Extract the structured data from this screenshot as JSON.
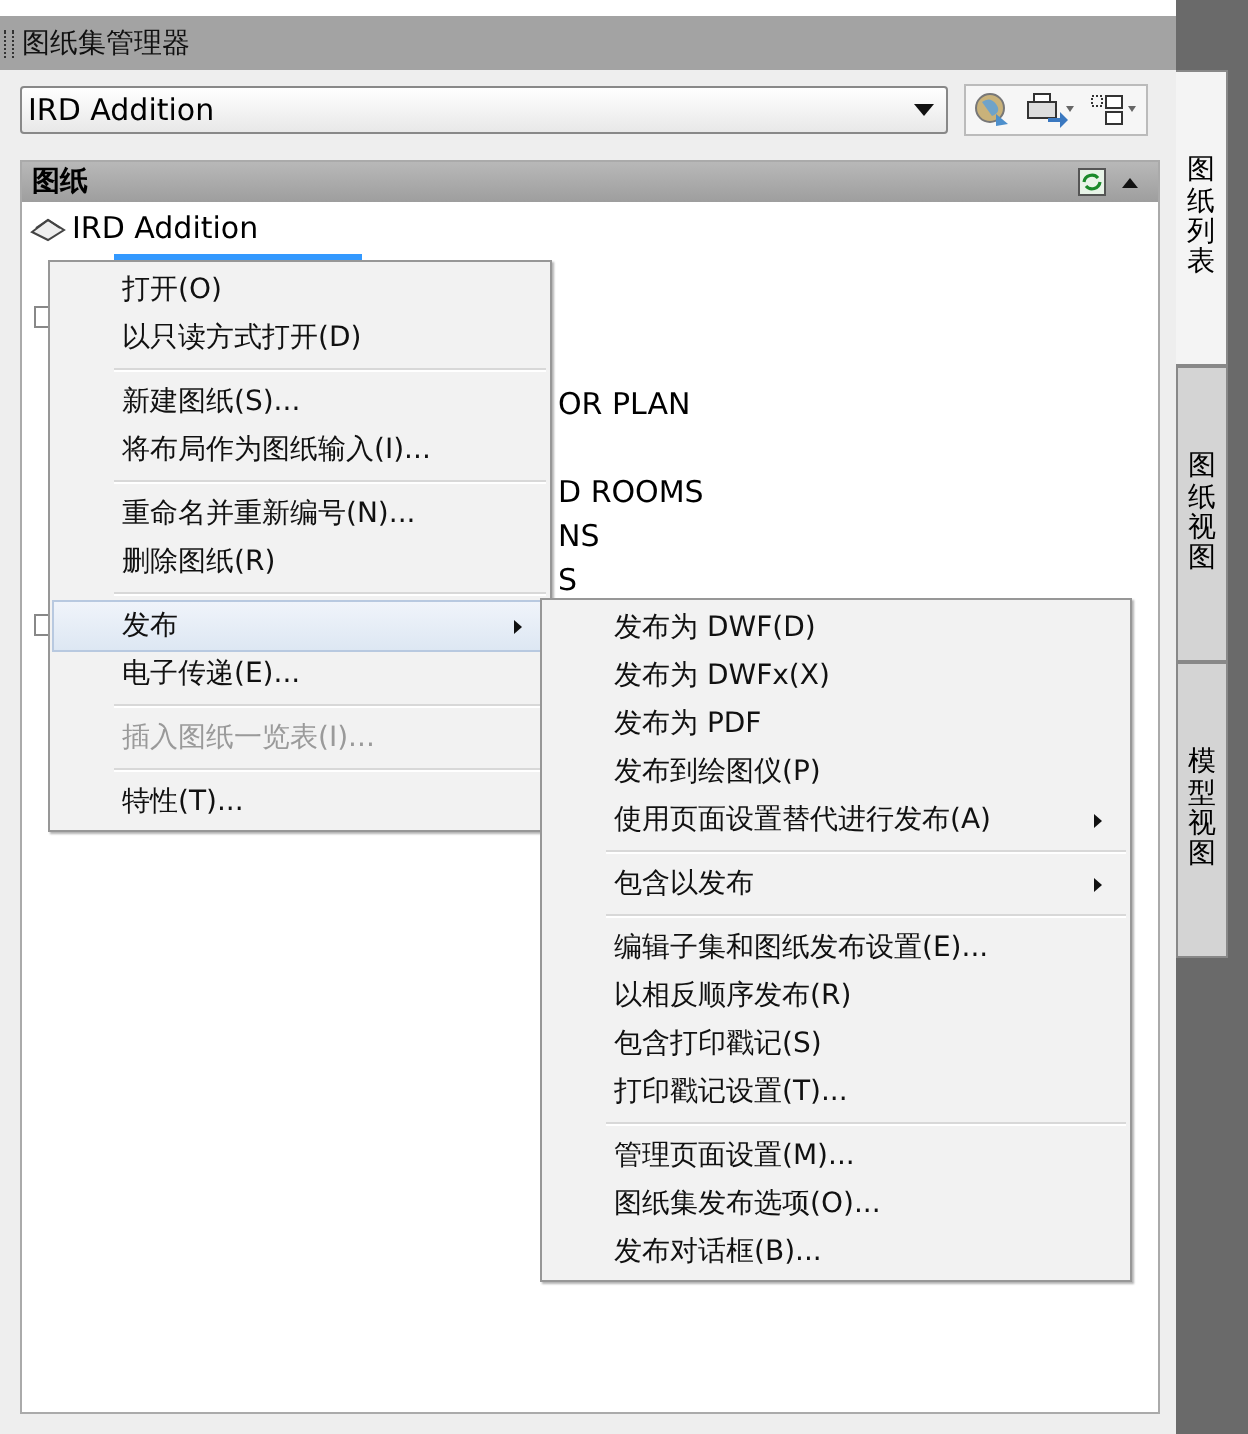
{
  "window": {
    "title": "图纸集管理器"
  },
  "sheet_set_dropdown": {
    "value": "IRD Addition"
  },
  "sheets_header": {
    "title": "图纸"
  },
  "tree": {
    "root": "IRD Addition",
    "rows": [
      {
        "kind": "selected",
        "text": ""
      },
      {
        "kind": "group",
        "text": ""
      },
      {
        "kind": "item",
        "text": ""
      },
      {
        "kind": "item",
        "text": "OR PLAN"
      },
      {
        "kind": "item",
        "text": ""
      },
      {
        "kind": "item",
        "text": "D ROOMS"
      },
      {
        "kind": "item",
        "text": "NS"
      },
      {
        "kind": "item",
        "text": "S"
      },
      {
        "kind": "group",
        "text": ""
      }
    ]
  },
  "context_menu": {
    "groups": [
      [
        {
          "label": "打开(O)",
          "disabled": false,
          "selected": false,
          "submenu": false
        },
        {
          "label": "以只读方式打开(D)",
          "disabled": false,
          "selected": false,
          "submenu": false
        }
      ],
      [
        {
          "label": "新建图纸(S)...",
          "disabled": false,
          "selected": false,
          "submenu": false
        },
        {
          "label": "将布局作为图纸输入(I)...",
          "disabled": false,
          "selected": false,
          "submenu": false
        }
      ],
      [
        {
          "label": "重命名并重新编号(N)...",
          "disabled": false,
          "selected": false,
          "submenu": false
        },
        {
          "label": "删除图纸(R)",
          "disabled": false,
          "selected": false,
          "submenu": false
        }
      ],
      [
        {
          "label": "发布",
          "disabled": false,
          "selected": true,
          "submenu": true
        },
        {
          "label": "电子传递(E)...",
          "disabled": false,
          "selected": false,
          "submenu": false
        }
      ],
      [
        {
          "label": "插入图纸一览表(I)...",
          "disabled": true,
          "selected": false,
          "submenu": false
        }
      ],
      [
        {
          "label": "特性(T)...",
          "disabled": false,
          "selected": false,
          "submenu": false
        }
      ]
    ]
  },
  "publish_submenu": {
    "groups": [
      [
        {
          "label": "发布为 DWF(D)",
          "submenu": false
        },
        {
          "label": "发布为 DWFx(X)",
          "submenu": false
        },
        {
          "label": "发布为 PDF",
          "submenu": false
        },
        {
          "label": "发布到绘图仪(P)",
          "submenu": false
        },
        {
          "label": "使用页面设置替代进行发布(A)",
          "submenu": true
        }
      ],
      [
        {
          "label": "包含以发布",
          "submenu": true
        }
      ],
      [
        {
          "label": "编辑子集和图纸发布设置(E)...",
          "submenu": false
        },
        {
          "label": "以相反顺序发布(R)",
          "submenu": false
        },
        {
          "label": "包含打印戳记(S)",
          "submenu": false
        },
        {
          "label": "打印戳记设置(T)...",
          "submenu": false
        }
      ],
      [
        {
          "label": "管理页面设置(M)...",
          "submenu": false
        },
        {
          "label": "图纸集发布选项(O)...",
          "submenu": false
        },
        {
          "label": "发布对话框(B)...",
          "submenu": false
        }
      ]
    ]
  },
  "side_tabs": [
    {
      "label": "图纸列表",
      "selected": true
    },
    {
      "label": "图纸视图",
      "selected": false
    },
    {
      "label": "模型视图",
      "selected": false
    }
  ]
}
